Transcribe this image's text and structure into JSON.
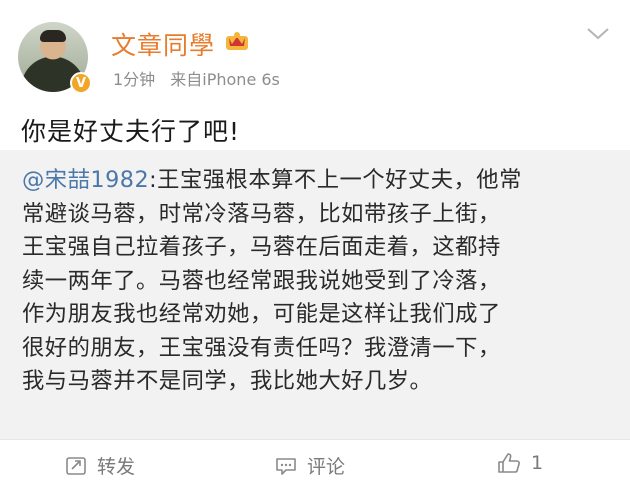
{
  "user": {
    "name": "文章同學",
    "verified_badge": "V",
    "time": "1分钟",
    "source": "来自iPhone 6s"
  },
  "post": {
    "text": "你是好丈夫行了吧!"
  },
  "repost": {
    "mention": "@宋喆1982",
    "lines": [
      ":王宝强根本算不上一个好丈夫，他常",
      "常避谈马蓉，时常冷落马蓉，比如带孩子上街，",
      "王宝强自己拉着孩子，马蓉在后面走着，这都持",
      "续一两年了。马蓉也经常跟我说她受到了冷落，",
      "作为朋友我也经常劝她，可能是这样让我们成了",
      "很好的朋友，王宝强没有责任吗？我澄清一下，",
      "我与马蓉并不是同学，我比她大好几岁。"
    ]
  },
  "actions": {
    "repost_label": "转发",
    "comment_label": "评论",
    "like_count": "1"
  },
  "colors": {
    "username": "#e87c2d",
    "mention": "#4b78a8",
    "repost_bg": "#f2f2f2",
    "meta": "#8d8d8d"
  },
  "icons": [
    "crown-icon",
    "chevron-down-icon",
    "repost-icon",
    "comment-icon",
    "like-icon"
  ]
}
